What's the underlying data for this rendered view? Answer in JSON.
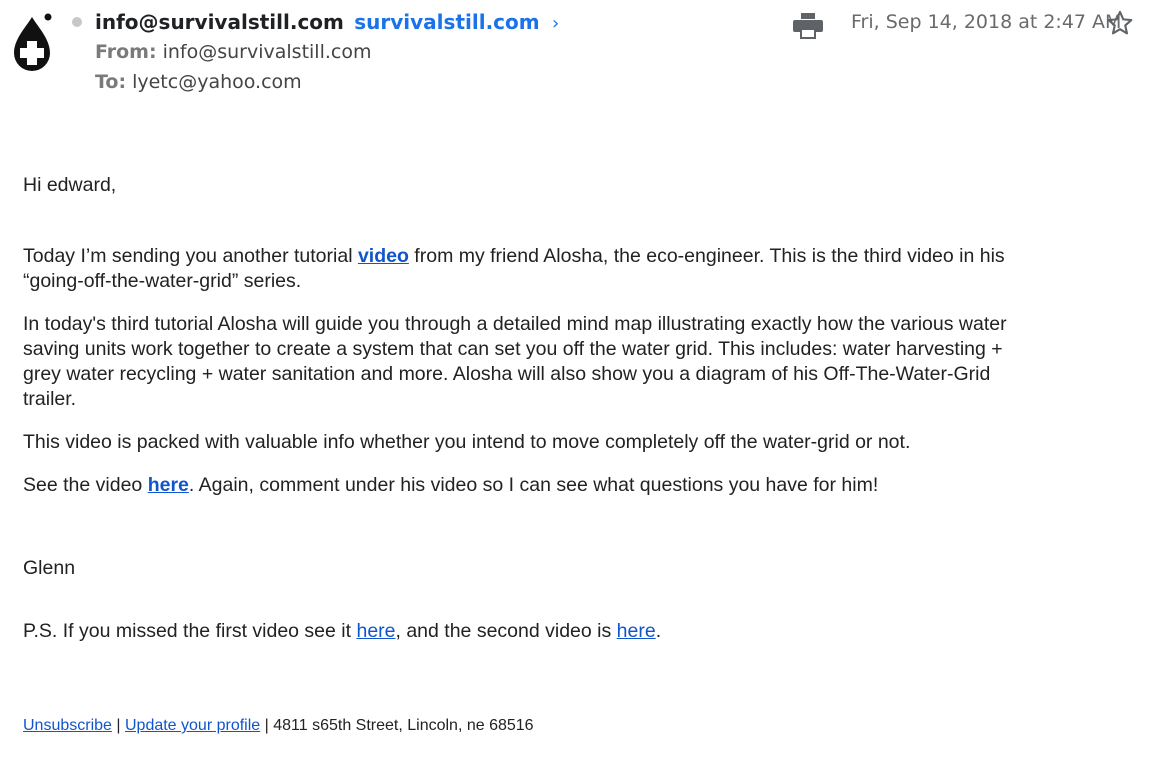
{
  "header": {
    "sender_name": "info@survivalstill.com",
    "sender_domain": "survivalstill.com",
    "chevron": "›",
    "from_label": "From:",
    "from_value": "info@survivalstill.com",
    "to_label": "To:",
    "to_value": "lyetc@yahoo.com",
    "date": "Fri, Sep 14, 2018 at 2:47 AM",
    "avatar_icon": "water-drop-plus-icon",
    "print_icon": "print-icon",
    "star_icon": "star-icon"
  },
  "body": {
    "greeting": "Hi edward,",
    "p1_before": "Today I’m sending you another tutorial ",
    "p1_link": "video",
    "p1_after": " from my friend Alosha, the eco-engineer. This is the third video in his “going-off-the-water-grid” series.",
    "p2": "In today's third tutorial Alosha will guide you through a detailed mind map illustrating exactly how the various water saving units work together to create a system that can set you off the water grid. This includes: water harvesting + grey water recycling + water sanitation and more. Alosha will also show you a diagram of his Off-The-Water-Grid trailer.",
    "p3": "This video is packed with valuable info whether you intend to move completely off the water-grid or not.",
    "p4_before": "See the video ",
    "p4_link": "here",
    "p4_after": ". Again, comment under his video so I can see what questions you have for him!",
    "signature": "Glenn",
    "ps_before": "P.S. If you missed the first video see it ",
    "ps_link1": "here",
    "ps_middle": ", and the second video is ",
    "ps_link2": "here",
    "ps_after": "."
  },
  "footer": {
    "unsubscribe": "Unsubscribe",
    "sep1": " | ",
    "update_profile": "Update your profile",
    "sep2": " | ",
    "address": "4811 s65th Street, Lincoln, ne 68516"
  },
  "colors": {
    "link": "#1155cc",
    "sender_domain": "#1a73e8",
    "text": "#222222",
    "muted": "#6a6a6a"
  }
}
